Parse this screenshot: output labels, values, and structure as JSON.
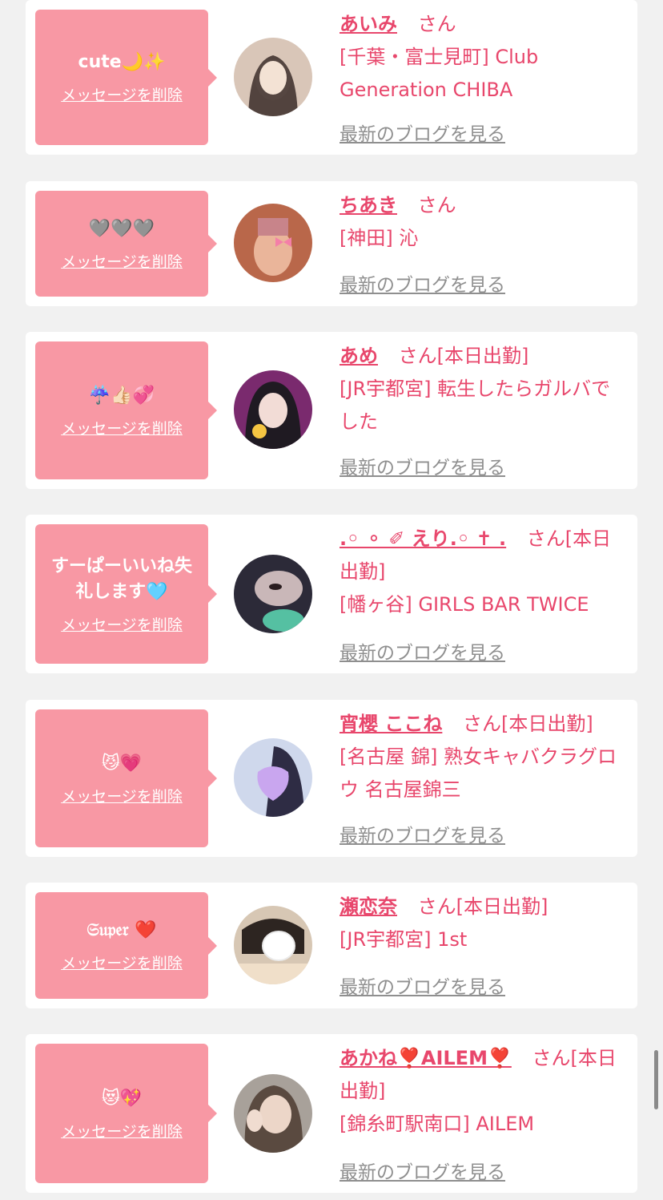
{
  "delete_label": "メッセージを削除",
  "blog_label": "最新のブログを見る",
  "san": "さん",
  "colors": {
    "bubble": "#f898a4",
    "name": "#e8476c",
    "link_gray": "#8f8f8f",
    "background": "#f1f1f1"
  },
  "cards": [
    {
      "message": "cute🌙✨",
      "name": "あいみ",
      "status": "",
      "shop": "[千葉・富士見町] Club Generation CHIBA",
      "avatar_icon": "profile-photo"
    },
    {
      "message": "🩶🩶🩶",
      "name": "ちあき",
      "status": "",
      "shop": "[神田] 沁",
      "avatar_icon": "profile-photo"
    },
    {
      "message": "☔️👍🏻💞",
      "name": "あめ",
      "status": "[本日出勤]",
      "shop": "[JR宇都宮] 転生したらガルバでした",
      "avatar_icon": "profile-photo"
    },
    {
      "message": "すーぱーいいね失礼します🩵",
      "name": ".◦ ⚬ ✐ えり.◦ ✝ .",
      "status": "[本日出勤]",
      "shop": "[幡ヶ谷] GIRLS BAR TWICE",
      "avatar_icon": "profile-photo"
    },
    {
      "message": "😼💗",
      "name": "宵櫻 ここね",
      "status": "[本日出勤]",
      "shop": "[名古屋 錦] 熟女キャバクラグロウ 名古屋錦三",
      "avatar_icon": "profile-photo"
    },
    {
      "message": "𝔖𝔲𝔭𝔢𝔯 ❤️",
      "name": "瀬恋奈",
      "status": "[本日出勤]",
      "shop": "[JR宇都宮] 1st",
      "avatar_icon": "profile-photo"
    },
    {
      "message": "😻💖",
      "name": "あかね❣️AILEM❣️",
      "status": "[本日出勤]",
      "shop": "[錦糸町駅南口] AILEM",
      "avatar_icon": "profile-photo"
    }
  ]
}
